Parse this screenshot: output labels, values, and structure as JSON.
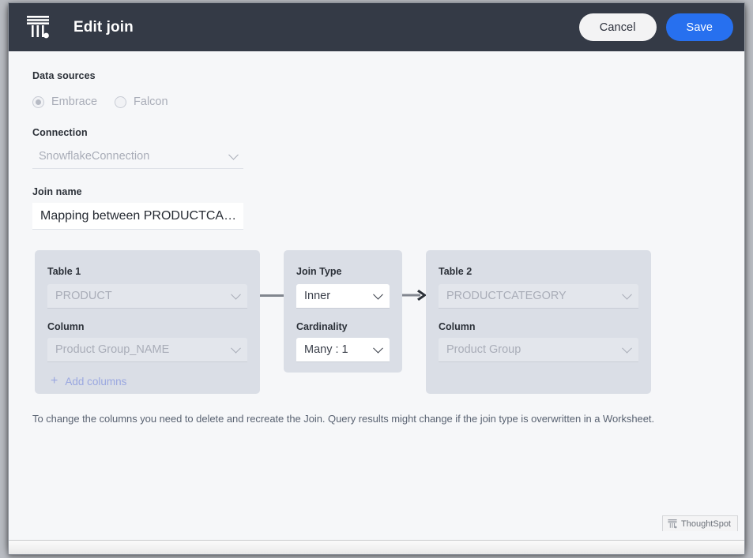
{
  "header": {
    "logo_icon": "thoughtspot-logo-icon",
    "title": "Edit join",
    "cancel_label": "Cancel",
    "save_label": "Save",
    "bg_color": "#343a46",
    "save_color": "#2770ef"
  },
  "form": {
    "data_sources_label": "Data sources",
    "radios": [
      {
        "label": "Embrace",
        "checked": true
      },
      {
        "label": "Falcon",
        "checked": false
      }
    ],
    "connection_label": "Connection",
    "connection_value": "SnowflakeConnection",
    "join_name_label": "Join name",
    "join_name_value": "Mapping between PRODUCTCA…"
  },
  "diagram": {
    "table1": {
      "title": "Table 1",
      "table_value": "PRODUCT",
      "column_label": "Column",
      "column_value": "Product Group_NAME",
      "add_columns_label": "Add columns",
      "plus_icon": "plus-icon"
    },
    "join": {
      "join_type_label": "Join Type",
      "join_type_value": "Inner",
      "cardinality_label": "Cardinality",
      "cardinality_value": "Many : 1"
    },
    "table2": {
      "title": "Table 2",
      "table_value": "PRODUCTCATEGORY",
      "column_label": "Column",
      "column_value": "Product Group"
    },
    "card_bg_color": "#dadee6"
  },
  "helper_note": "To change the columns you need to delete and recreate the Join. Query results might change if the join type is overwritten in a Worksheet.",
  "footer": {
    "brand_text": "ThoughtSpot",
    "brand_logo_icon": "thoughtspot-logo-icon"
  }
}
